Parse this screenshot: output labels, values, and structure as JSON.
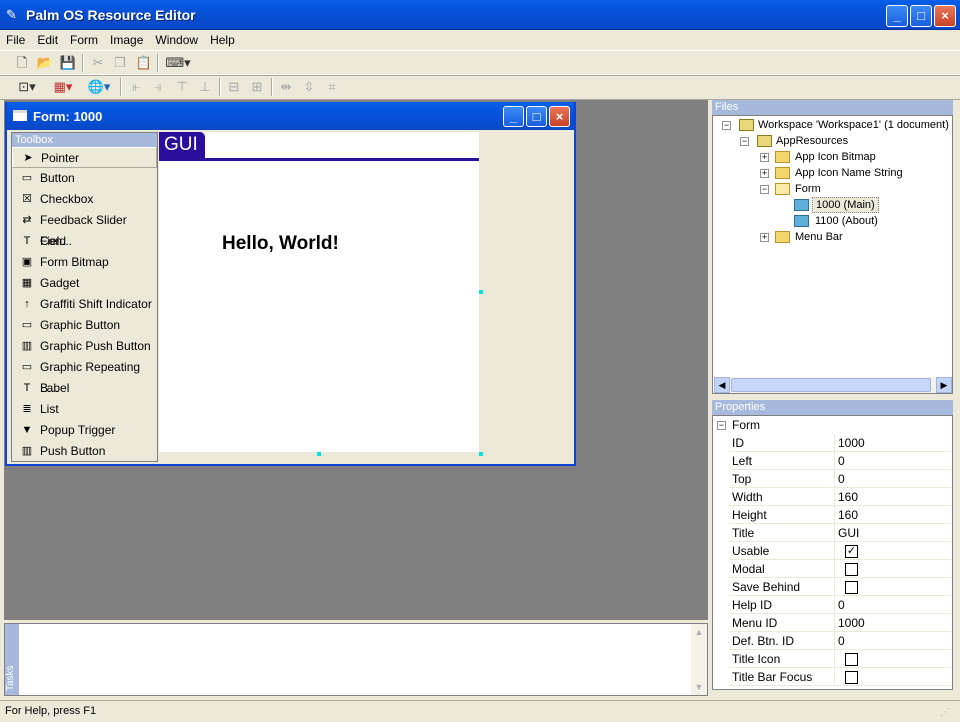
{
  "app": {
    "title": "Palm OS Resource Editor"
  },
  "menu": {
    "items": [
      "File",
      "Edit",
      "Form",
      "Image",
      "Window",
      "Help"
    ]
  },
  "caption": {
    "minimize": "_",
    "maximize": "□",
    "close": "×"
  },
  "form_window": {
    "title": "Form: 1000"
  },
  "toolbox": {
    "header": "Toolbox",
    "items": [
      {
        "label": "Pointer",
        "icon": "➤"
      },
      {
        "label": "Button",
        "icon": "▭"
      },
      {
        "label": "Checkbox",
        "icon": "☒"
      },
      {
        "label": "Feedback Slider Con...",
        "icon": "⇄"
      },
      {
        "label": "Field",
        "icon": "T"
      },
      {
        "label": "Form Bitmap",
        "icon": "▣"
      },
      {
        "label": "Gadget",
        "icon": "▦"
      },
      {
        "label": "Graffiti Shift Indicator",
        "icon": "↑"
      },
      {
        "label": "Graphic Button",
        "icon": "▭"
      },
      {
        "label": "Graphic Push Button",
        "icon": "▥"
      },
      {
        "label": "Graphic Repeating B...",
        "icon": "▭"
      },
      {
        "label": "Label",
        "icon": "T"
      },
      {
        "label": "List",
        "icon": "≣"
      },
      {
        "label": "Popup Trigger",
        "icon": "▼"
      },
      {
        "label": "Push Button",
        "icon": "▥"
      }
    ]
  },
  "canvas": {
    "title_tab": "GUI",
    "label_text": "Hello, World!"
  },
  "files": {
    "header": "Files",
    "workspace": "Workspace 'Workspace1' (1 document)",
    "app_resources": "AppResources",
    "app_icon_bitmap": "App Icon Bitmap",
    "app_icon_name": "App Icon Name String",
    "form": "Form",
    "form_main": "1000 (Main)",
    "form_about": "1100 (About)",
    "menu_bar": "Menu Bar"
  },
  "properties": {
    "header": "Properties",
    "group": "Form",
    "rows": [
      {
        "key": "ID",
        "value": "1000"
      },
      {
        "key": "Left",
        "value": "0"
      },
      {
        "key": "Top",
        "value": "0"
      },
      {
        "key": "Width",
        "value": "160"
      },
      {
        "key": "Height",
        "value": "160"
      },
      {
        "key": "Title",
        "value": "GUI"
      },
      {
        "key": "Usable",
        "value": "",
        "checkbox": true,
        "checked": true
      },
      {
        "key": "Modal",
        "value": "",
        "checkbox": true,
        "checked": false
      },
      {
        "key": "Save Behind",
        "value": "",
        "checkbox": true,
        "checked": false
      },
      {
        "key": "Help ID",
        "value": "0"
      },
      {
        "key": "Menu ID",
        "value": "1000"
      },
      {
        "key": "Def. Btn. ID",
        "value": "0"
      },
      {
        "key": "Title Icon",
        "value": "",
        "checkbox": true,
        "checked": false
      },
      {
        "key": "Title Bar Focus",
        "value": "",
        "checkbox": true,
        "checked": false
      }
    ]
  },
  "tasks": {
    "label": "Tasks"
  },
  "status": {
    "text": "For Help, press F1"
  }
}
